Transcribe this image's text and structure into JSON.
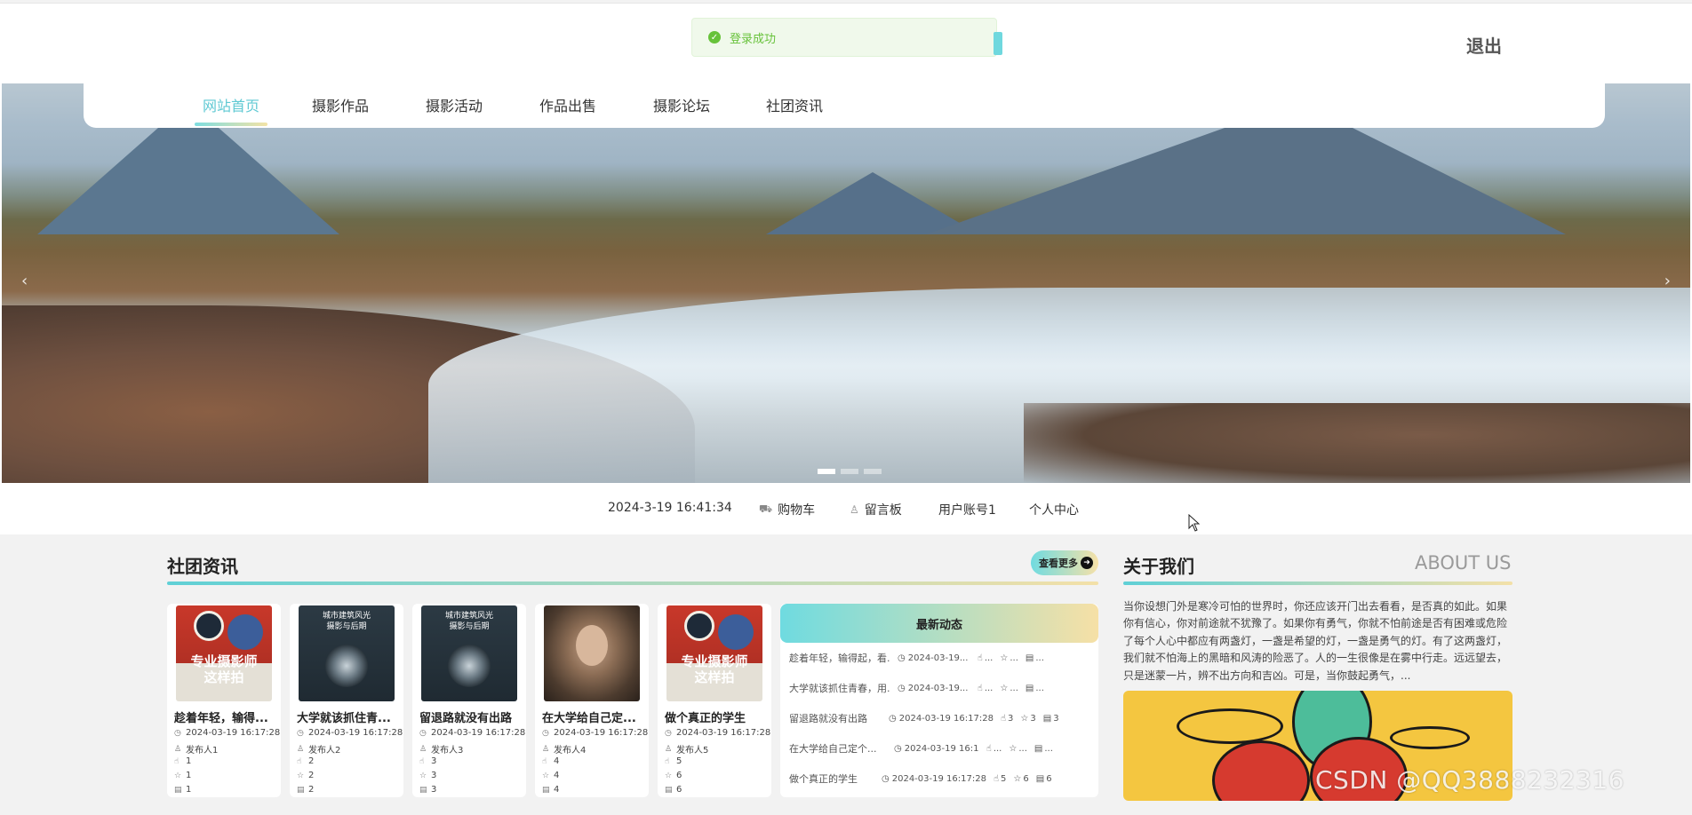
{
  "toast": {
    "message": "登录成功"
  },
  "header": {
    "logout_label": "退出"
  },
  "nav": {
    "items": [
      {
        "label": "网站首页",
        "active": true
      },
      {
        "label": "摄影作品"
      },
      {
        "label": "摄影活动"
      },
      {
        "label": "作品出售"
      },
      {
        "label": "摄影论坛"
      },
      {
        "label": "社团资讯"
      }
    ]
  },
  "banner": {
    "prev_icon": "‹",
    "next_icon": "›",
    "slide_count": 3,
    "active_slide": 1
  },
  "infobar": {
    "datetime": "2024-3-19 16:41:34",
    "cart_label": "购物车",
    "message_board_label": "留言板",
    "user_account": "用户账号1",
    "personal_center_label": "个人中心"
  },
  "news_section": {
    "title": "社团资讯",
    "more_label": "查看更多",
    "cards": [
      {
        "title": "趁着年轻，输得...",
        "time": "2024-03-19 16:17:28",
        "publisher": "发布人1",
        "likes": "1",
        "favorites": "1",
        "views": "1",
        "cover_text": "专业摄影师\n这样拍"
      },
      {
        "title": "大学就该抓住青...",
        "time": "2024-03-19 16:17:28",
        "publisher": "发布人2",
        "likes": "2",
        "favorites": "2",
        "views": "2",
        "cover_text": "城市建筑风光\n摄影与后期"
      },
      {
        "title": "留退路就没有出路",
        "time": "2024-03-19 16:17:28",
        "publisher": "发布人3",
        "likes": "3",
        "favorites": "3",
        "views": "3",
        "cover_text": "城市建筑风光\n摄影与后期"
      },
      {
        "title": "在大学给自己定...",
        "time": "2024-03-19 16:17:28",
        "publisher": "发布人4",
        "likes": "4",
        "favorites": "4",
        "views": "4",
        "cover_text": ""
      },
      {
        "title": "做个真正的学生",
        "time": "2024-03-19 16:17:28",
        "publisher": "发布人5",
        "likes": "5",
        "favorites": "6",
        "views": "6",
        "cover_text": "专业摄影师\n这样拍"
      }
    ]
  },
  "latest": {
    "title": "最新动态",
    "rows": [
      {
        "title": "趁着年轻，输得起，看...",
        "time": "2024-03-19...",
        "likes": "...",
        "favorites": "...",
        "views": "..."
      },
      {
        "title": "大学就该抓住青春，用...",
        "time": "2024-03-19...",
        "likes": "...",
        "favorites": "...",
        "views": "..."
      },
      {
        "title": "留退路就没有出路",
        "time": "2024-03-19 16:17:28",
        "likes": "3",
        "favorites": "3",
        "views": "3"
      },
      {
        "title": "在大学给自己定个...",
        "time": "2024-03-19 16:1...",
        "likes": "...",
        "favorites": "...",
        "views": "..."
      },
      {
        "title": "做个真正的学生",
        "time": "2024-03-19 16:17:28",
        "likes": "5",
        "favorites": "6",
        "views": "6"
      }
    ]
  },
  "about": {
    "title": "关于我们",
    "title_en": "ABOUT US",
    "text": "当你设想门外是寒冷可怕的世界时，你还应该开门出去看看，是否真的如此。如果你有信心，你对前途就不犹豫了。如果你有勇气，你就不怕前途是否有困难或危险了每个人心中都应有两盏灯，一盏是希望的灯，一盏是勇气的灯。有了这两盏灯，我们就不怕海上的黑暗和风涛的险恶了。人的一生很像是在雾中行走。远远望去，只是迷蒙一片，辨不出方向和吉凶。可是，当你鼓起勇气，..."
  },
  "watermark": "CSDN @QQ3888232316"
}
